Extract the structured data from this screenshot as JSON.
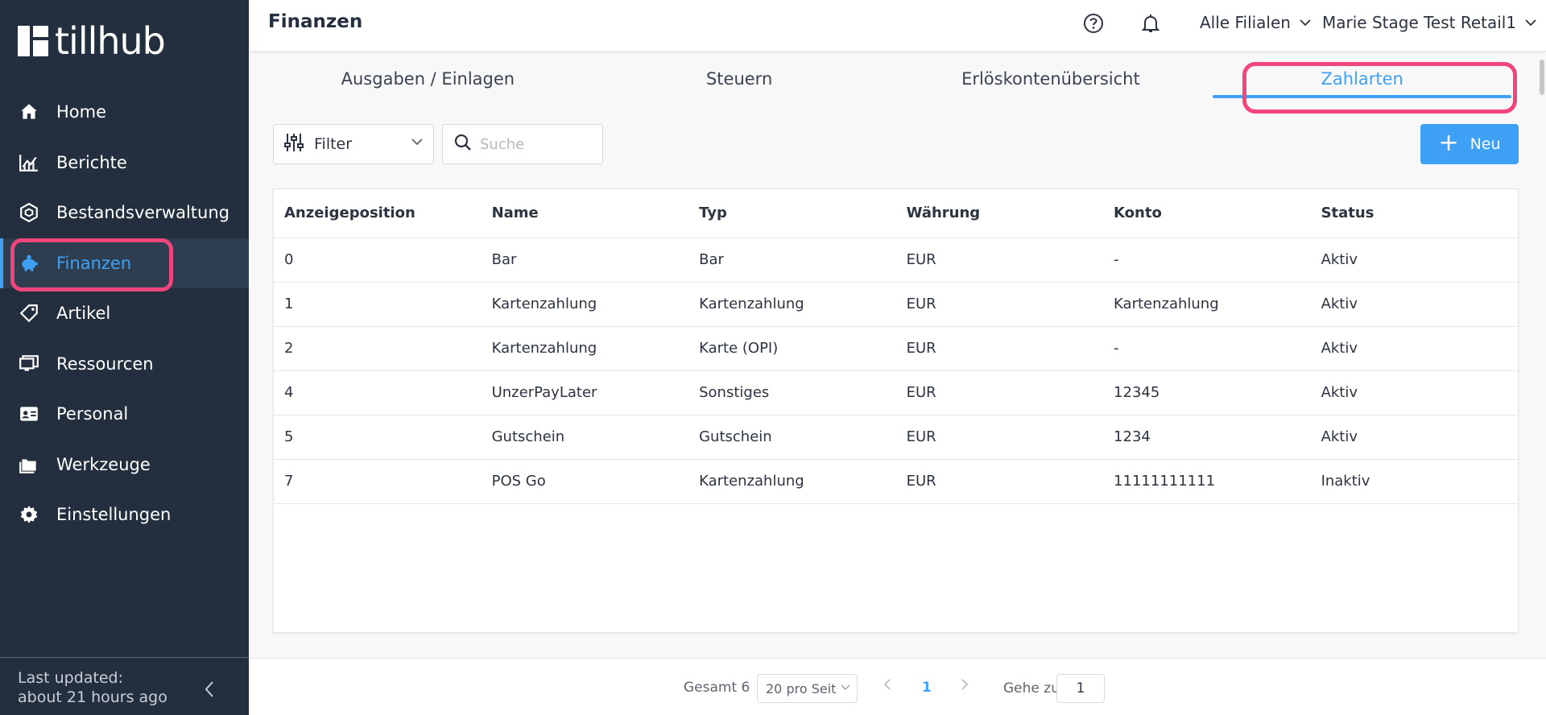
{
  "brand": {
    "name": "tillhub"
  },
  "sidebar": {
    "items": [
      {
        "label": "Home",
        "icon": "home-icon"
      },
      {
        "label": "Berichte",
        "icon": "chart-icon"
      },
      {
        "label": "Bestandsverwaltung",
        "icon": "inventory-icon"
      },
      {
        "label": "Finanzen",
        "icon": "piggy-bank-icon",
        "active": true
      },
      {
        "label": "Artikel",
        "icon": "tag-icon"
      },
      {
        "label": "Ressourcen",
        "icon": "monitor-icon"
      },
      {
        "label": "Personal",
        "icon": "id-card-icon"
      },
      {
        "label": "Werkzeuge",
        "icon": "folder-icon"
      },
      {
        "label": "Einstellungen",
        "icon": "gear-icon"
      }
    ],
    "footer": {
      "line1": "Last updated:",
      "line2": "about 21 hours ago"
    }
  },
  "header": {
    "title": "Finanzen",
    "branch_select": "Alle Filialen",
    "user_select": "Marie Stage Test Retail1"
  },
  "tabs": [
    {
      "label": "Ausgaben / Einlagen"
    },
    {
      "label": "Steuern"
    },
    {
      "label": "Erlöskontenübersicht"
    },
    {
      "label": "Zahlarten",
      "active": true
    }
  ],
  "toolbar": {
    "filter_label": "Filter",
    "search_placeholder": "Suche",
    "new_label": "Neu"
  },
  "table": {
    "columns": [
      "Anzeigeposition",
      "Name",
      "Typ",
      "Währung",
      "Konto",
      "Status"
    ],
    "rows": [
      [
        "0",
        "Bar",
        "Bar",
        "EUR",
        "-",
        "Aktiv"
      ],
      [
        "1",
        "Kartenzahlung",
        "Kartenzahlung",
        "EUR",
        "Kartenzahlung",
        "Aktiv"
      ],
      [
        "2",
        "Kartenzahlung",
        "Karte (OPI)",
        "EUR",
        "-",
        "Aktiv"
      ],
      [
        "4",
        "UnzerPayLater",
        "Sonstiges",
        "EUR",
        "12345",
        "Aktiv"
      ],
      [
        "5",
        "Gutschein",
        "Gutschein",
        "EUR",
        "1234",
        "Aktiv"
      ],
      [
        "7",
        "POS Go",
        "Kartenzahlung",
        "EUR",
        "11111111111",
        "Inaktiv"
      ]
    ]
  },
  "pagination": {
    "total": "Gesamt 6",
    "page_size": "20 pro Seit",
    "current_page": "1",
    "goto_label": "Gehe zu",
    "goto_value": "1"
  },
  "colors": {
    "accent": "#3ea1f5",
    "sidebar_bg": "#232f3e",
    "highlight": "#f0457d"
  }
}
